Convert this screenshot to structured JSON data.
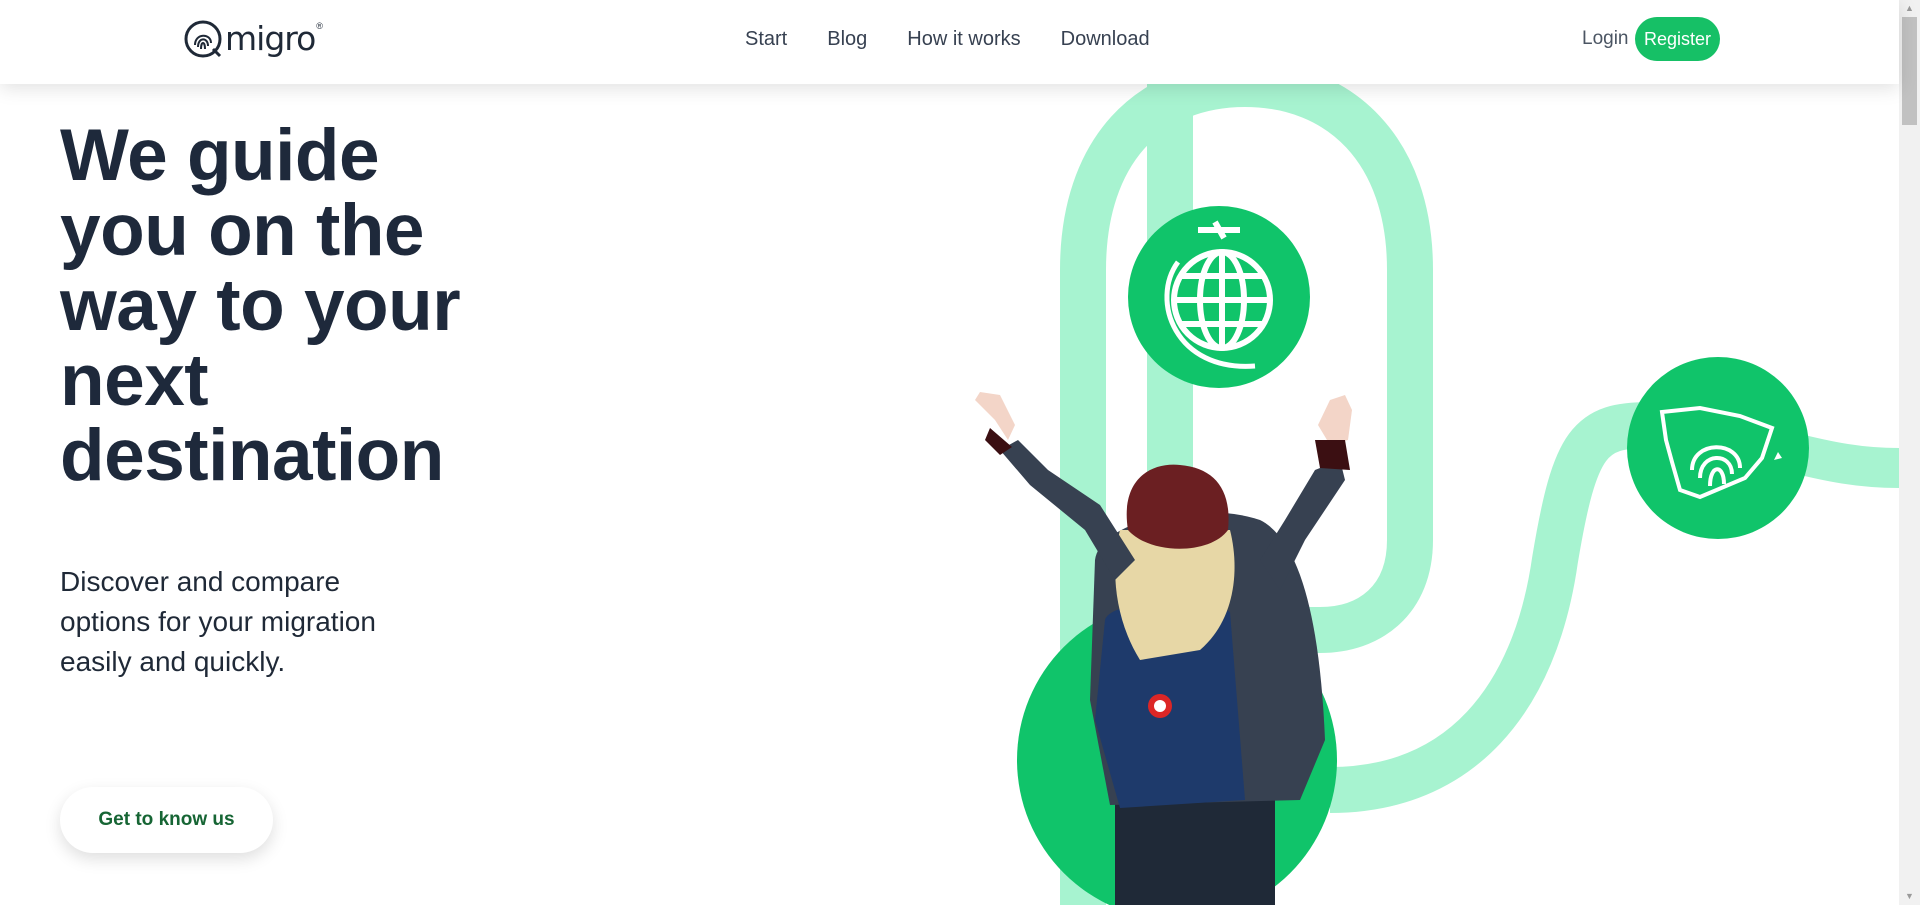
{
  "header": {
    "logo_text": "migro",
    "logo_mark": "®",
    "nav": [
      {
        "label": "Start"
      },
      {
        "label": "Blog"
      },
      {
        "label": "How it works"
      },
      {
        "label": "Download"
      }
    ],
    "login_label": "Login",
    "register_label": "Register"
  },
  "hero": {
    "title": "We guide you on the way to your next destination",
    "subtitle": "Discover and compare options for your migration easily and quickly.",
    "cta_label": "Get to know us"
  },
  "illustration": {
    "icons": [
      "globe-plane-icon",
      "spain-fingerprint-icon"
    ],
    "colors": {
      "path": "#a7f3d0",
      "circle": "#10c46a",
      "dark": "#1e293b"
    }
  },
  "colors": {
    "accent": "#16c066",
    "text_dark": "#1e293b",
    "cta_text": "#166534"
  }
}
